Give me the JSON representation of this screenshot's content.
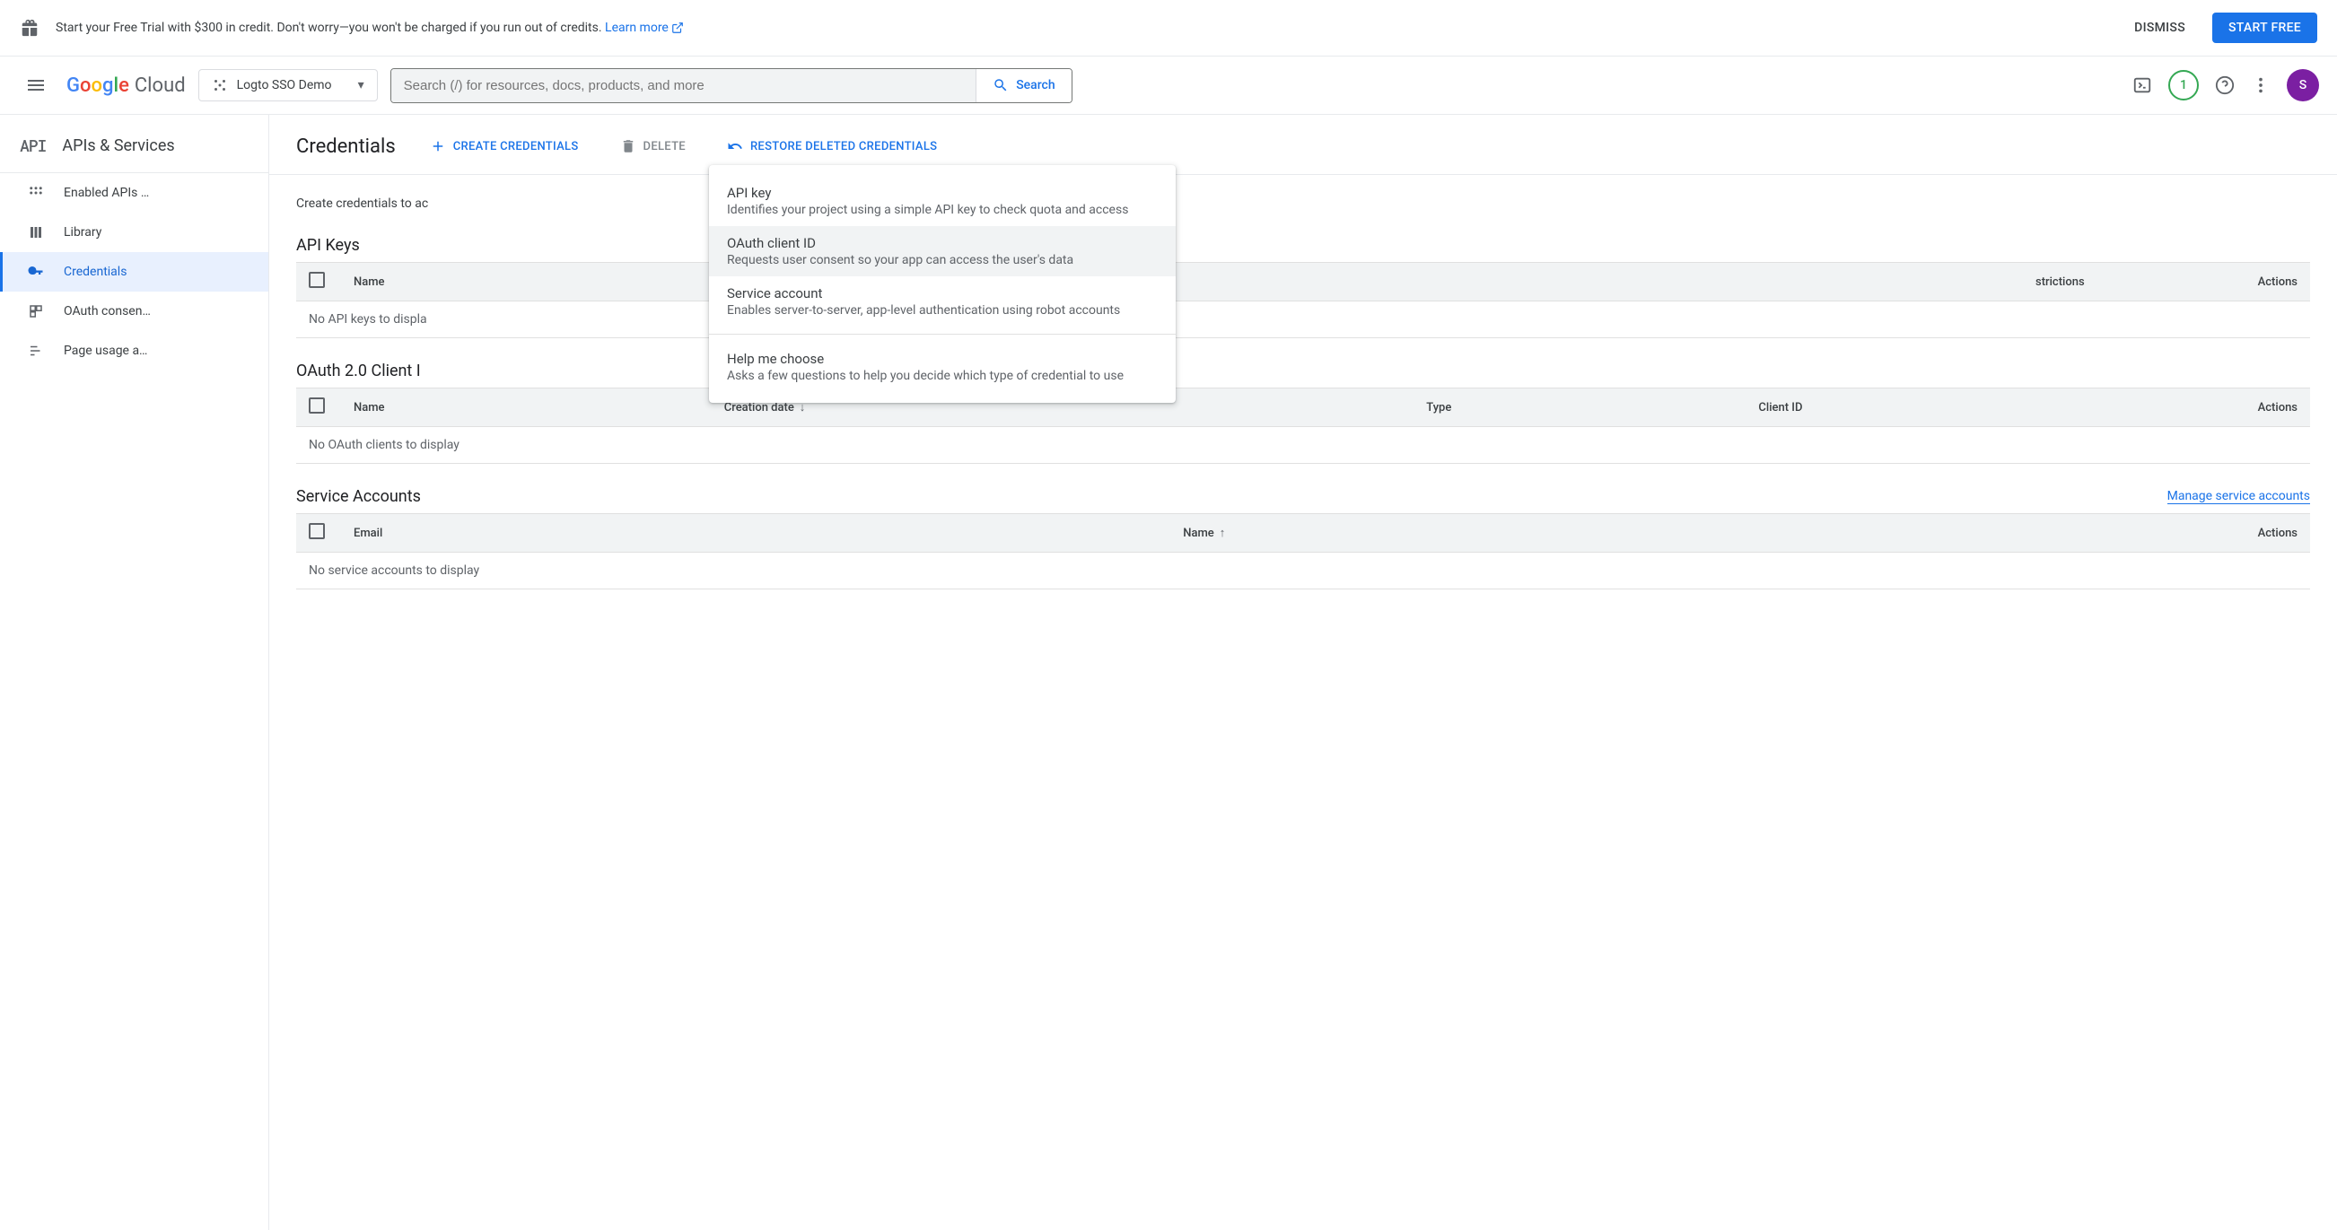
{
  "banner": {
    "message": "Start your Free Trial with $300 in credit. Don't worry—you won't be charged if you run out of credits. ",
    "learn_more": "Learn more",
    "dismiss": "DISMISS",
    "start_free": "START FREE"
  },
  "header": {
    "logo_cloud": "Cloud",
    "project_name": "Logto SSO Demo",
    "search_placeholder": "Search (/) for resources, docs, products, and more",
    "search_button": "Search",
    "notif_count": "1",
    "avatar_letter": "S"
  },
  "sidebar": {
    "section_title": "APIs & Services",
    "items": [
      {
        "label": "Enabled APIs …"
      },
      {
        "label": "Library"
      },
      {
        "label": "Credentials"
      },
      {
        "label": "OAuth consen…"
      },
      {
        "label": "Page usage a…"
      }
    ]
  },
  "page": {
    "title": "Credentials",
    "create_label": "CREATE CREDENTIALS",
    "delete_label": "DELETE",
    "restore_label": "RESTORE DELETED CREDENTIALS",
    "intro": "Create credentials to ac"
  },
  "dropdown": {
    "items": [
      {
        "title": "API key",
        "desc": "Identifies your project using a simple API key to check quota and access"
      },
      {
        "title": "OAuth client ID",
        "desc": "Requests user consent so your app can access the user's data"
      },
      {
        "title": "Service account",
        "desc": "Enables server-to-server, app-level authentication using robot accounts"
      },
      {
        "title": "Help me choose",
        "desc": "Asks a few questions to help you decide which type of credential to use"
      }
    ]
  },
  "tables": {
    "api_keys": {
      "heading": "API Keys",
      "cols": {
        "name": "Name",
        "restrictions_partial": "strictions",
        "actions": "Actions"
      },
      "empty": "No API keys to displa"
    },
    "oauth": {
      "heading": "OAuth 2.0 Client I",
      "cols": {
        "name": "Name",
        "creation": "Creation date",
        "type": "Type",
        "client_id": "Client ID",
        "actions": "Actions"
      },
      "empty": "No OAuth clients to display"
    },
    "service": {
      "heading": "Service Accounts",
      "manage": "Manage service accounts",
      "cols": {
        "email": "Email",
        "name": "Name",
        "actions": "Actions"
      },
      "empty": "No service accounts to display"
    }
  }
}
